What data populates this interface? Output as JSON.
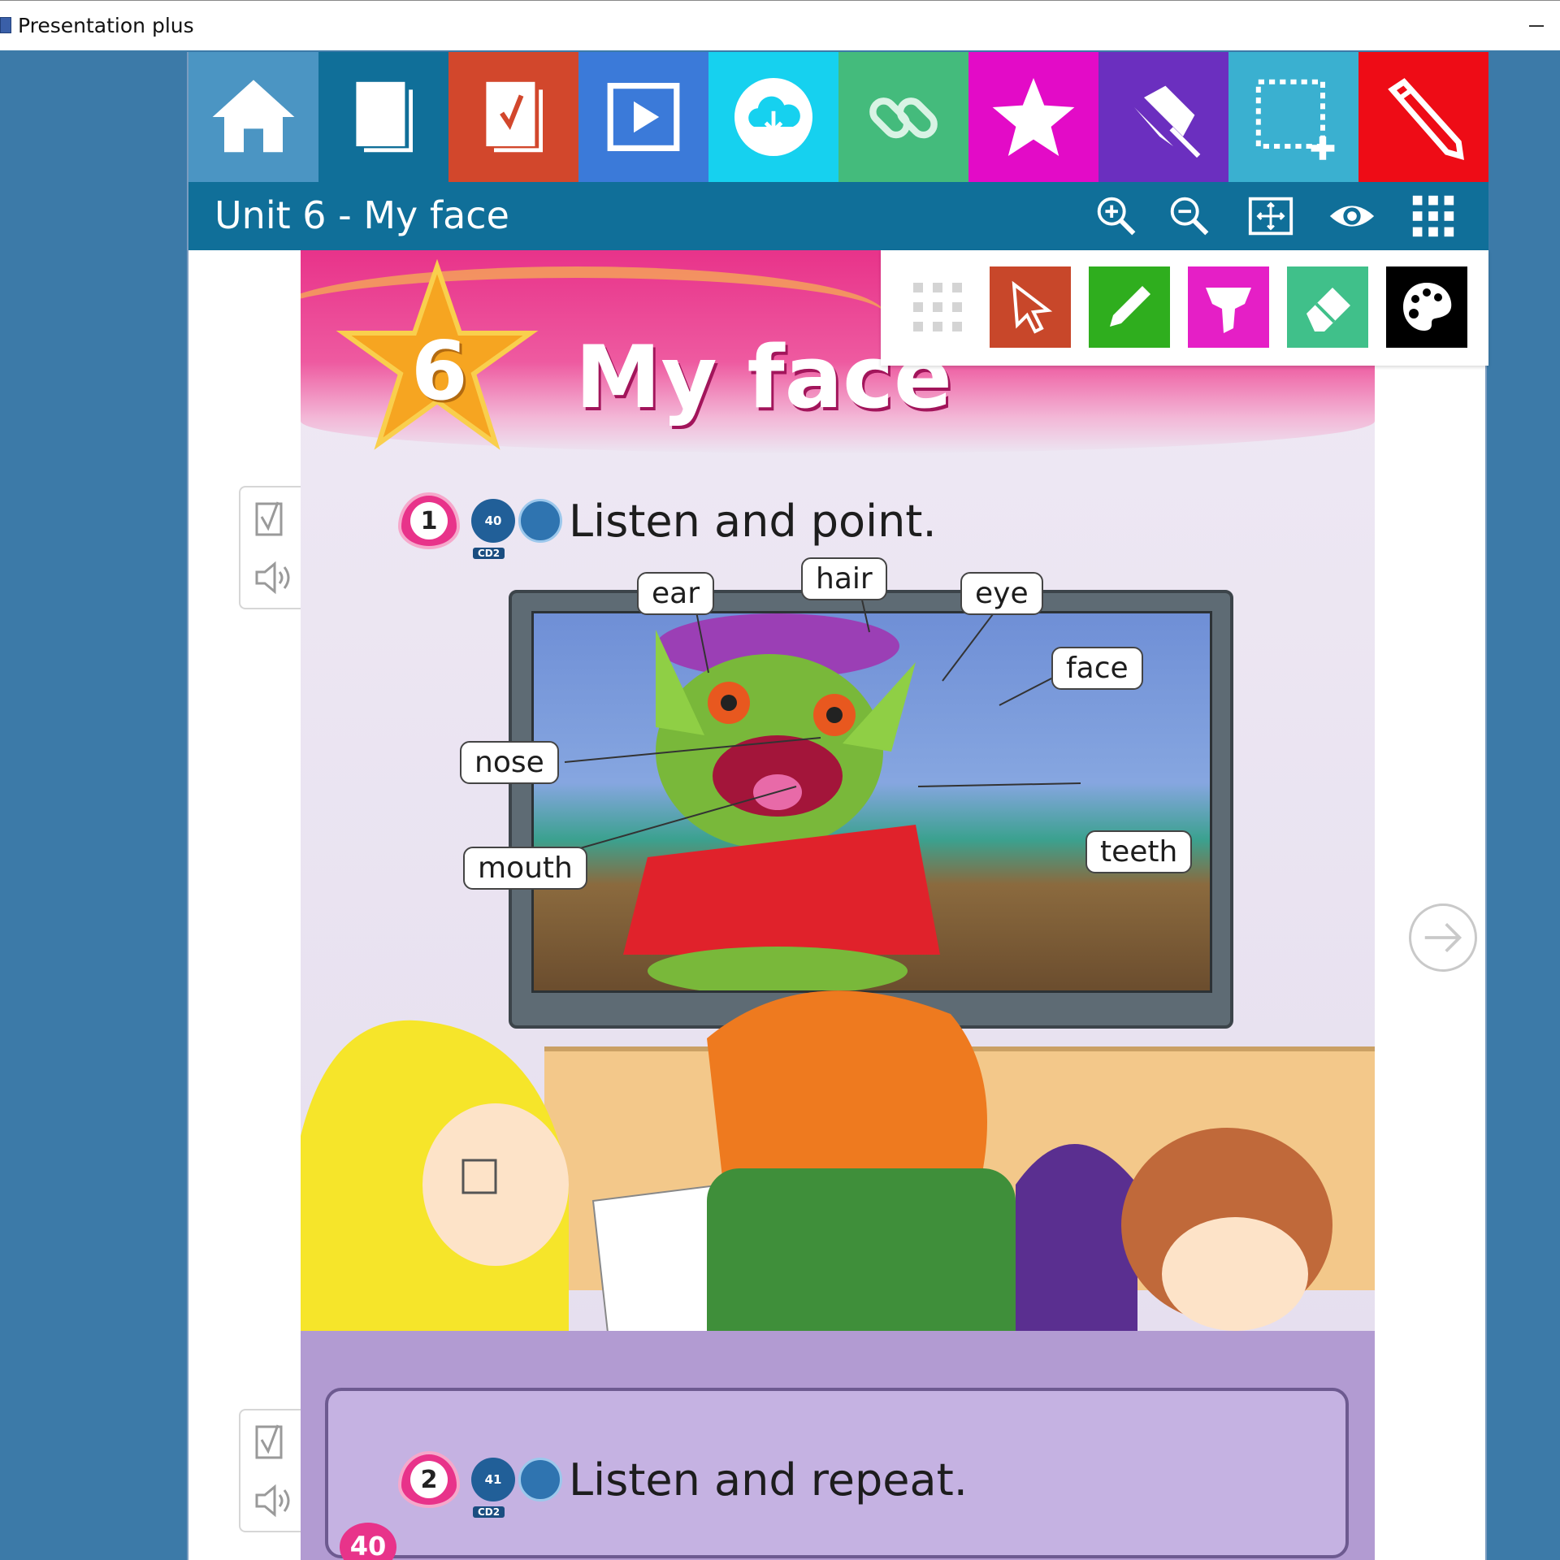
{
  "window": {
    "title": "Presentation plus"
  },
  "toolbar": {
    "items": [
      {
        "icon": "home-icon",
        "color": "#4b95c3"
      },
      {
        "icon": "pages-icon",
        "color": "#106f99"
      },
      {
        "icon": "answer-key-icon",
        "color": "#d2472c"
      },
      {
        "icon": "play-icon",
        "color": "#3b7ad9"
      },
      {
        "icon": "cloud-download-icon",
        "color": "#16d1ef"
      },
      {
        "icon": "link-icon",
        "color": "#44bb7c"
      },
      {
        "icon": "star-icon",
        "color": "#e30bc7"
      },
      {
        "icon": "pin-icon",
        "color": "#6b2fbf"
      },
      {
        "icon": "select-area-icon",
        "color": "#3ab0d0"
      },
      {
        "icon": "pen-icon",
        "color": "#ee0c16"
      }
    ]
  },
  "unit_bar": {
    "title": "Unit 6 - My face",
    "tools": [
      "zoom-in-icon",
      "zoom-out-icon",
      "fit-screen-icon",
      "view-icon",
      "grid-icon"
    ]
  },
  "pen_panel": {
    "tools": [
      {
        "icon": "drag-handle-icon",
        "color": "#ffffff"
      },
      {
        "icon": "pointer-icon",
        "color": "#c8472a"
      },
      {
        "icon": "pencil-icon",
        "color": "#2fae1e"
      },
      {
        "icon": "highlighter-icon",
        "color": "#e51fc6"
      },
      {
        "icon": "eraser-icon",
        "color": "#40c08a"
      },
      {
        "icon": "palette-icon",
        "color": "#000000"
      }
    ]
  },
  "page": {
    "unit_number": "6",
    "title": "My face",
    "exercise1": {
      "number": "1",
      "track": "40",
      "cd": "CD2",
      "instruction": "Listen and point."
    },
    "exercise2": {
      "number": "2",
      "track": "41",
      "cd": "CD2",
      "instruction": "Listen and repeat."
    },
    "labels": [
      "ear",
      "hair",
      "eye",
      "face",
      "nose",
      "teeth",
      "mouth"
    ],
    "page_number": "40"
  },
  "colors": {
    "background": "#3c7aa8",
    "unit_bar": "#106f99",
    "banner_pink": "#e8338a"
  }
}
